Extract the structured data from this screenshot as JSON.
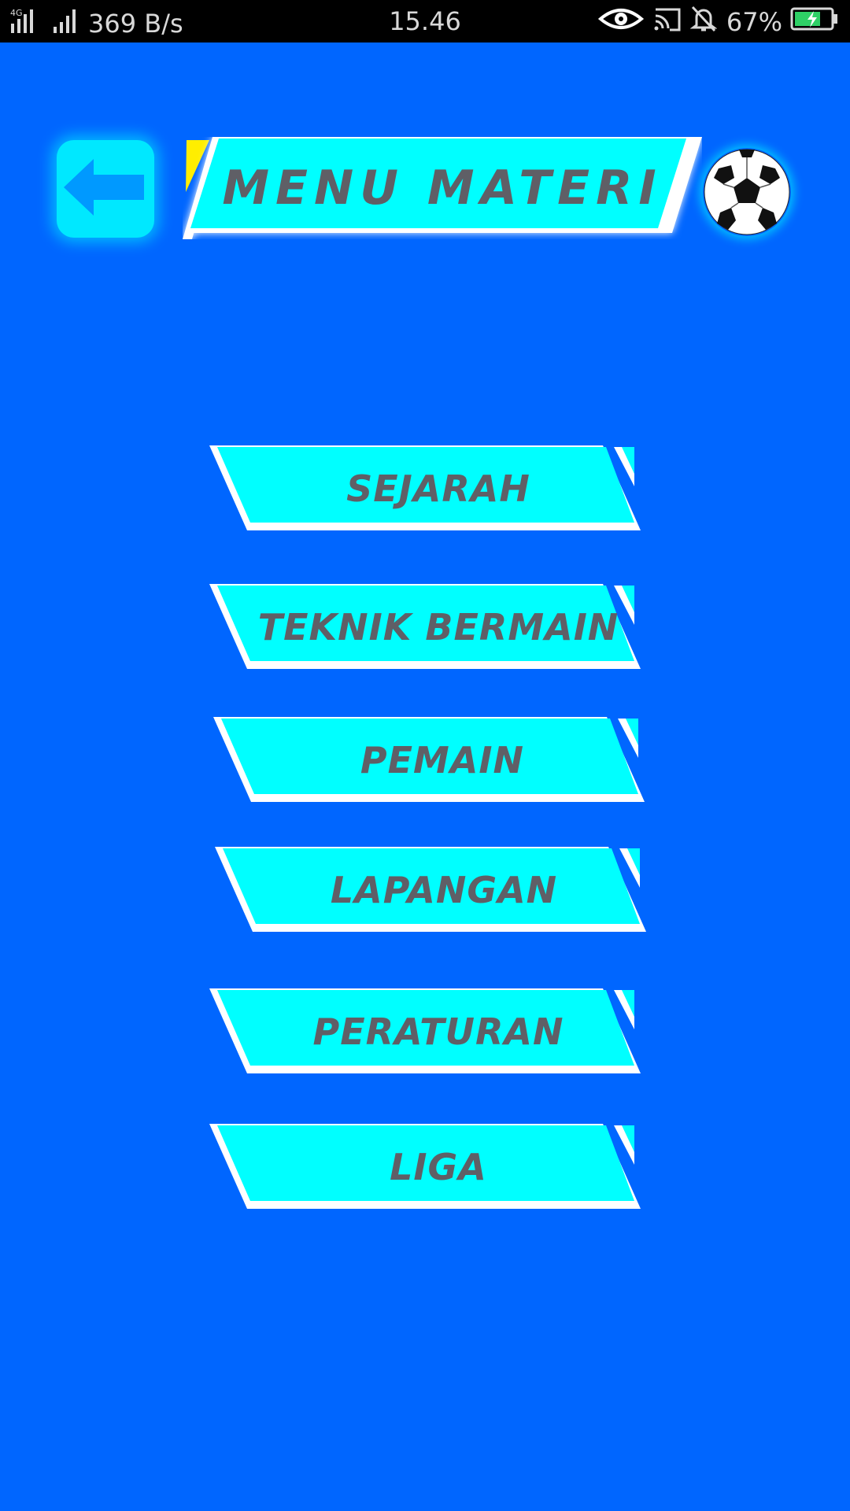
{
  "status_bar": {
    "network": "4G",
    "speed": "369 B/s",
    "time": "15.46",
    "battery_pct": "67%"
  },
  "header": {
    "back_icon": "arrow-left-icon",
    "title": "MENU MATERI",
    "ball_icon": "soccer-ball-icon"
  },
  "menu": {
    "items": [
      {
        "label": "SEJARAH"
      },
      {
        "label": "TEKNIK BERMAIN"
      },
      {
        "label": "PEMAIN"
      },
      {
        "label": "LAPANGAN"
      },
      {
        "label": "PERATURAN"
      },
      {
        "label": "LIGA"
      }
    ]
  },
  "colors": {
    "background": "#0066ff",
    "button_fill": "#00ffff",
    "button_text": "#5f5f66",
    "stripe": "#ffffff",
    "accent_yellow": "#ffee00"
  }
}
